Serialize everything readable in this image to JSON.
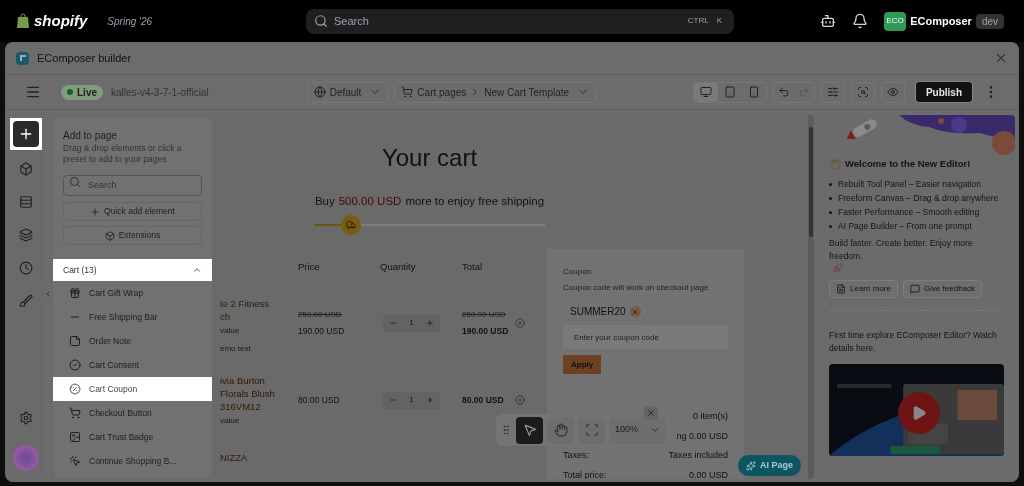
{
  "topbar": {
    "brand": "shopify",
    "release": "Spring '26",
    "search": {
      "placeholder": "Search",
      "shortcut": [
        "CTRL",
        "K"
      ]
    },
    "account": {
      "initials": "ECO",
      "name": "EComposer",
      "badge": "dev"
    }
  },
  "window": {
    "title": "EComposer builder"
  },
  "toolbar": {
    "status": "Live",
    "theme": "kalles-v4-3-7-1-official",
    "language": "Default",
    "breadcrumb": [
      "Cart pages",
      "New Cart Template"
    ],
    "devices": [
      {
        "kind": "desktop",
        "selected": true
      },
      {
        "kind": "tablet",
        "selected": false
      },
      {
        "kind": "mobile",
        "selected": false
      }
    ],
    "publish": "Publish"
  },
  "rail": [
    {
      "kind": "add",
      "selected": true
    },
    {
      "kind": "elements",
      "selected": false
    },
    {
      "kind": "sections",
      "selected": false
    },
    {
      "kind": "layers",
      "selected": false
    },
    {
      "kind": "history",
      "selected": false
    },
    {
      "kind": "styles",
      "selected": false
    }
  ],
  "panel": {
    "title": "Add to page",
    "description": "Drag & drop elements or click a preset to add to your pages",
    "search": {
      "placeholder": "Search"
    },
    "buttons": [
      "Quick add element",
      "Extensions"
    ],
    "group": {
      "label": "Cart (13)",
      "expanded": true
    },
    "items": [
      {
        "label": "Cart Gift Wrap",
        "selected": false
      },
      {
        "label": "Free Shipping Bar",
        "selected": false
      },
      {
        "label": "Order Note",
        "selected": false
      },
      {
        "label": "Cart Consent",
        "selected": false
      },
      {
        "label": "Cart Coupon",
        "selected": true
      },
      {
        "label": "Checkout Button",
        "selected": false
      },
      {
        "label": "Cart Trust Badge",
        "selected": false
      },
      {
        "label": "Continue Shopping B...",
        "selected": false
      }
    ]
  },
  "canvas": {
    "title": "Your cart",
    "shipping": {
      "prefix": "Buy",
      "amount": "500.00 USD",
      "suffix": "more to enjoy free shipping",
      "level": 0.16
    },
    "columns": [
      "Price",
      "Quantity",
      "Total"
    ],
    "rows": [
      {
        "name": [
          "te 2 Fitness",
          "ch"
        ],
        "details": [
          "value",
          "emo text"
        ],
        "price_old": "250.00 USD",
        "price": "190.00 USD",
        "quantity": "1",
        "total_old": "250.00 USD",
        "total": "190.00 USD"
      },
      {
        "name": [
          "ivia Burton",
          "Florals Blush",
          "316VM12"
        ],
        "details": [
          "value"
        ],
        "price": "80.00 USD",
        "quantity": "1",
        "total": "80.00 USD"
      },
      {
        "name": [
          "NIZZA"
        ]
      }
    ],
    "coupon": {
      "label": "Coupon:",
      "note": "Coupon code will work on checkout page",
      "applied": [
        "SUMMER20"
      ],
      "placeholder": "Enter your coupon code",
      "button": "Apply"
    },
    "summary": [
      {
        "value": "0 item(s)"
      },
      {
        "value": "ng 0.00 USD"
      },
      {
        "label": "Taxes:",
        "value": "Taxes included"
      },
      {
        "label": "Total price:",
        "value": "0.00 USD"
      }
    ]
  },
  "floating_toolbar": {
    "tools": [
      {
        "kind": "pointer",
        "selected": true
      },
      {
        "kind": "hand",
        "selected": false
      },
      {
        "kind": "fit",
        "selected": false
      }
    ],
    "zoom": "100%"
  },
  "ai_button": "AI Page",
  "welcome": {
    "title": "Welcome to the New Editor!",
    "features": [
      {
        "name": "Rebuilt Tool Panel",
        "separator": "–",
        "text": "Easier navigation"
      },
      {
        "name": "Freeform Canvas",
        "separator": "–",
        "text": "Drag & drop anywhere"
      },
      {
        "name": "Faster Performance",
        "separator": "–",
        "text": "Smooth editing"
      },
      {
        "name": "AI Page Builder",
        "separator": "–",
        "text": "From one prompt"
      }
    ],
    "tagline": "Build faster. Create better. Enjoy more freedom.",
    "buttons": [
      {
        "kind": "docs",
        "label": "Learn more"
      },
      {
        "kind": "feedback",
        "label": "Give feedback"
      }
    ],
    "video_intro": "First time explore EComposer Editor? Watch details here."
  }
}
